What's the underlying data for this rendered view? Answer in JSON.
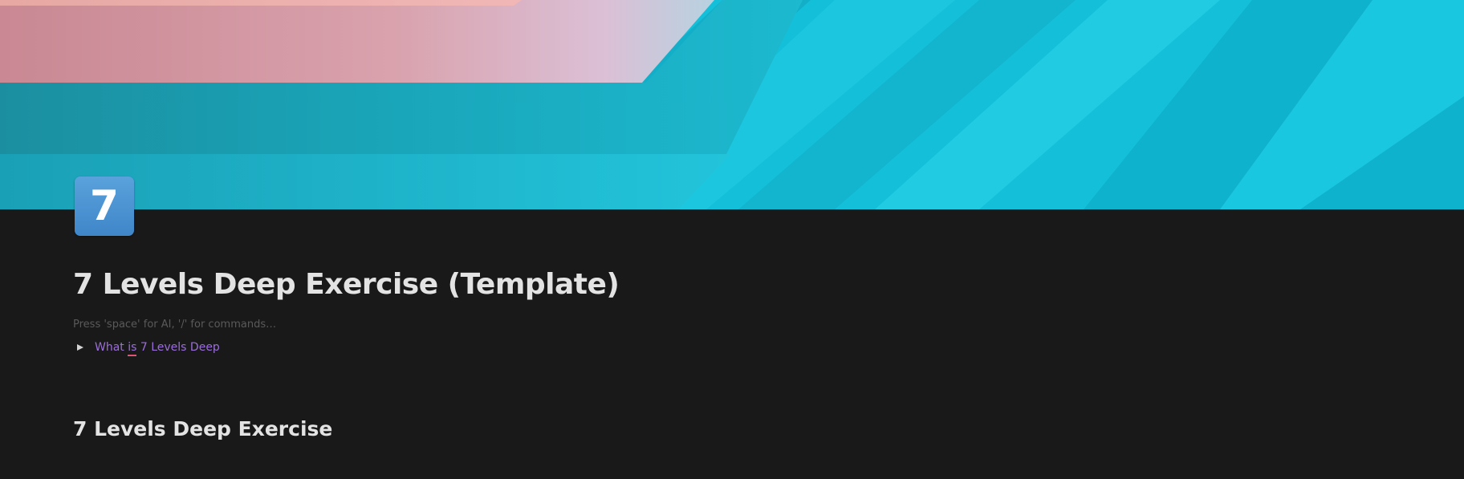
{
  "cover": {
    "description_colors": {
      "cyan": "#12c3dc",
      "pink": "#e3a3b1",
      "teal": "#148fa3"
    }
  },
  "page_icon": {
    "text": "7",
    "color": "#4a90d0"
  },
  "page": {
    "title": "7 Levels Deep Exercise (Template)",
    "placeholder": "Press 'space' for AI, '/' for commands…"
  },
  "toggle": {
    "label_before": "What ",
    "label_spell": "is",
    "label_after": " 7 Levels Deep",
    "color": "#9b6fd9"
  },
  "section": {
    "heading": "7 Levels Deep Exercise"
  }
}
